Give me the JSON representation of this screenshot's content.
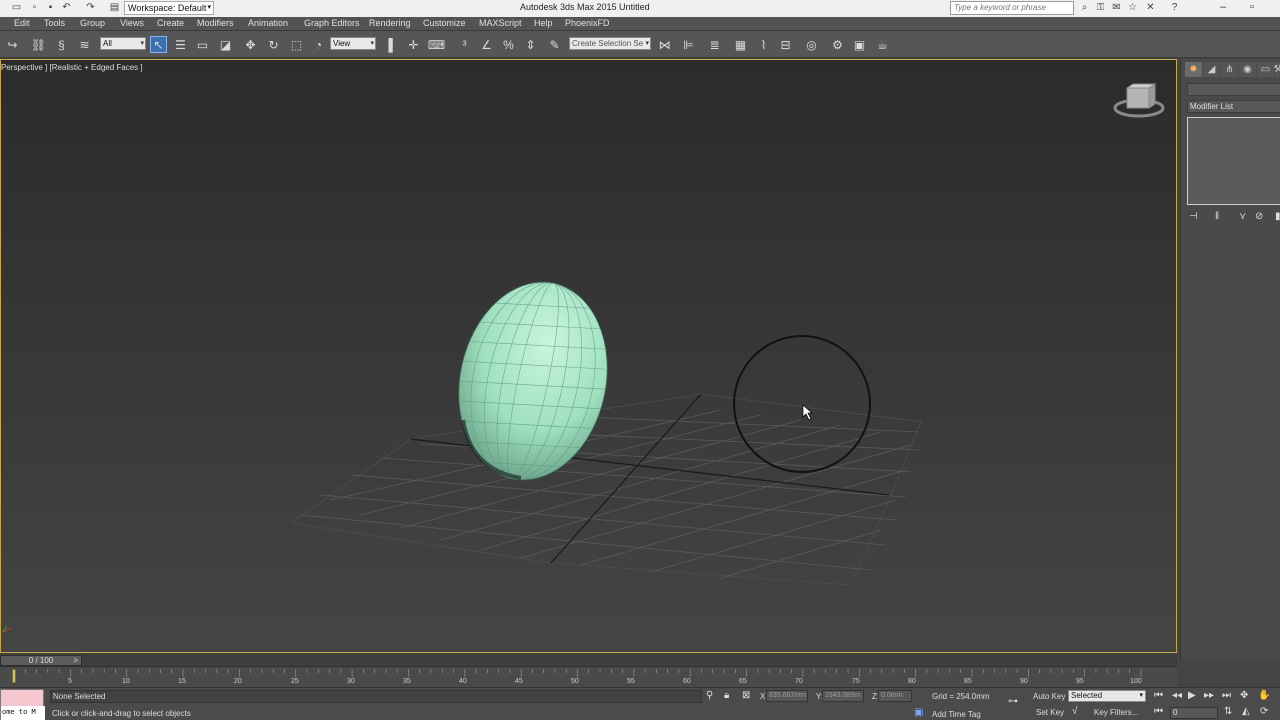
{
  "window": {
    "title": "Autodesk 3ds Max  2015     Untitled",
    "workspace_label": "Workspace: Default",
    "search_placeholder": "Type a keyword or phrase"
  },
  "menu": {
    "items": [
      "Edit",
      "Tools",
      "Group",
      "Views",
      "Create",
      "Modifiers",
      "Animation",
      "Graph Editors",
      "Rendering",
      "Customize",
      "MAXScript",
      "Help",
      "PhoenixFD"
    ]
  },
  "toolbar": {
    "selection_filter": "All",
    "reference_coord": "View",
    "named_selection_placeholder": "Create Selection Se"
  },
  "viewport": {
    "label": "Perspective ] [Realistic + Edged Faces ]",
    "mesh_color": "#a8e8c8",
    "border_color": "#caa84a"
  },
  "command_panel": {
    "modifier_list": "Modifier List"
  },
  "timeline": {
    "range_label": "0 / 100",
    "ticks": [
      "5",
      "10",
      "15",
      "20",
      "25",
      "30",
      "35",
      "40",
      "45",
      "50",
      "55",
      "60",
      "65",
      "70",
      "75",
      "80",
      "85",
      "90",
      "95",
      "100"
    ]
  },
  "status": {
    "maxscript_text": "ome to M",
    "selection": "None Selected",
    "prompt": "Click or click-and-drag to select objects",
    "x_label": "X:",
    "x_value": "835.667mm",
    "y_label": "Y:",
    "y_value": "1843.089m",
    "z_label": "Z:",
    "z_value": "0.0mm",
    "grid": "Grid = 254.0mm",
    "add_time_tag": "Add Time Tag",
    "auto_key": "Auto Key",
    "set_key": "Set Key",
    "key_mode": "Selected",
    "key_filters": "Key Filters...",
    "current_frame": "0"
  }
}
